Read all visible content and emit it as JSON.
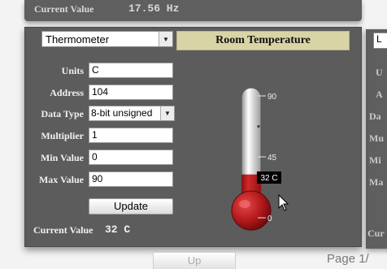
{
  "top_panel": {
    "current_value_label": "Current Value",
    "current_value": "17.56 Hz"
  },
  "right_panel": {
    "select_value": "L",
    "label_letters": [
      "U",
      "A",
      "Da",
      "Mu",
      "Mi",
      "Ma",
      "Cur"
    ]
  },
  "widget": {
    "type_select": "Thermometer",
    "title": "Room Temperature",
    "fields": {
      "units": {
        "label": "Units",
        "value": "C"
      },
      "address": {
        "label": "Address",
        "value": "104"
      },
      "data_type": {
        "label": "Data Type",
        "value": "8-bit unsigned"
      },
      "multiplier": {
        "label": "Multiplier",
        "value": "1"
      },
      "min_value": {
        "label": "Min Value",
        "value": "0"
      },
      "max_value": {
        "label": "Max Value",
        "value": "90"
      }
    },
    "update_label": "Update",
    "current_value_label": "Current Value",
    "current_value": "32 C"
  },
  "thermometer": {
    "min": 0,
    "max": 90,
    "value": 32,
    "ticks": [
      {
        "value": 90,
        "label": "90"
      },
      {
        "value": 45,
        "label": "45"
      },
      {
        "value": 0,
        "label": "0"
      }
    ],
    "value_label": "32 C",
    "fill_color": "#b3191b"
  },
  "bottom": {
    "up_label": "Up",
    "page_label": "Page 1/"
  },
  "colors": {
    "panel_bg": "#5c5c5c",
    "title_bg": "#d9d4a6"
  }
}
